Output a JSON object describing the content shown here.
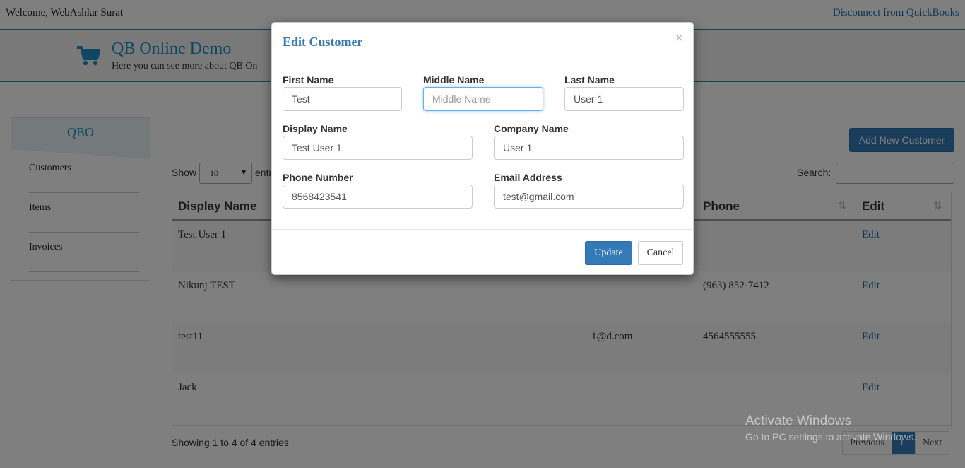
{
  "header": {
    "welcome": "Welcome, WebAshlar Surat",
    "disconnect_link": "Disconnect from QuickBooks"
  },
  "banner": {
    "title": "QB Online Demo",
    "subtitle": "Here you can see more about QB On"
  },
  "sidebar": {
    "title": "QBO",
    "items": [
      {
        "label": "Customers"
      },
      {
        "label": "Items"
      },
      {
        "label": "Invoices"
      }
    ]
  },
  "toolbar": {
    "add_button": "Add New Customer",
    "show_label": "Show",
    "page_length": "10",
    "entries_label": "entri",
    "search_label": "Search:"
  },
  "table": {
    "headers": {
      "display_name": "Display Name",
      "phone": "Phone",
      "edit": "Edit"
    },
    "rows": [
      {
        "display_name": "Test User 1",
        "email": "",
        "phone": "",
        "edit": "Edit"
      },
      {
        "display_name": "Nikunj TEST",
        "email": "",
        "phone": "(963) 852-7412",
        "edit": "Edit"
      },
      {
        "display_name": "test11",
        "email": "1@d.com",
        "phone": "4564555555",
        "edit": "Edit"
      },
      {
        "display_name": "Jack",
        "email": "",
        "phone": "",
        "edit": "Edit"
      }
    ],
    "info": "Showing 1 to 4 of 4 entries",
    "pagination": {
      "previous": "Previous",
      "current": "1",
      "next": "Next"
    }
  },
  "watermark": {
    "line1": "Activate Windows",
    "line2": "Go to PC settings to activate Windows."
  },
  "modal": {
    "title": "Edit Customer",
    "close": "×",
    "fields": {
      "first_name": {
        "label": "First Name",
        "value": "Test",
        "placeholder": "First Name"
      },
      "middle_name": {
        "label": "Middle Name",
        "value": "",
        "placeholder": "Middle Name"
      },
      "last_name": {
        "label": "Last Name",
        "value": "User 1",
        "placeholder": "Last Name"
      },
      "display_name": {
        "label": "Display Name",
        "value": "Test User 1",
        "placeholder": "Display Name"
      },
      "company_name": {
        "label": "Company Name",
        "value": "User 1",
        "placeholder": "Company Name"
      },
      "phone_number": {
        "label": "Phone Number",
        "value": "8568423541",
        "placeholder": "Phone Number"
      },
      "email_address": {
        "label": "Email Address",
        "value": "test@gmail.com",
        "placeholder": "Email Address"
      }
    },
    "update_button": "Update",
    "cancel_button": "Cancel"
  },
  "colors": {
    "primary": "#337ab7",
    "brand": "#1a8fc9",
    "overlay": "rgba(0,0,0,0.5)"
  }
}
